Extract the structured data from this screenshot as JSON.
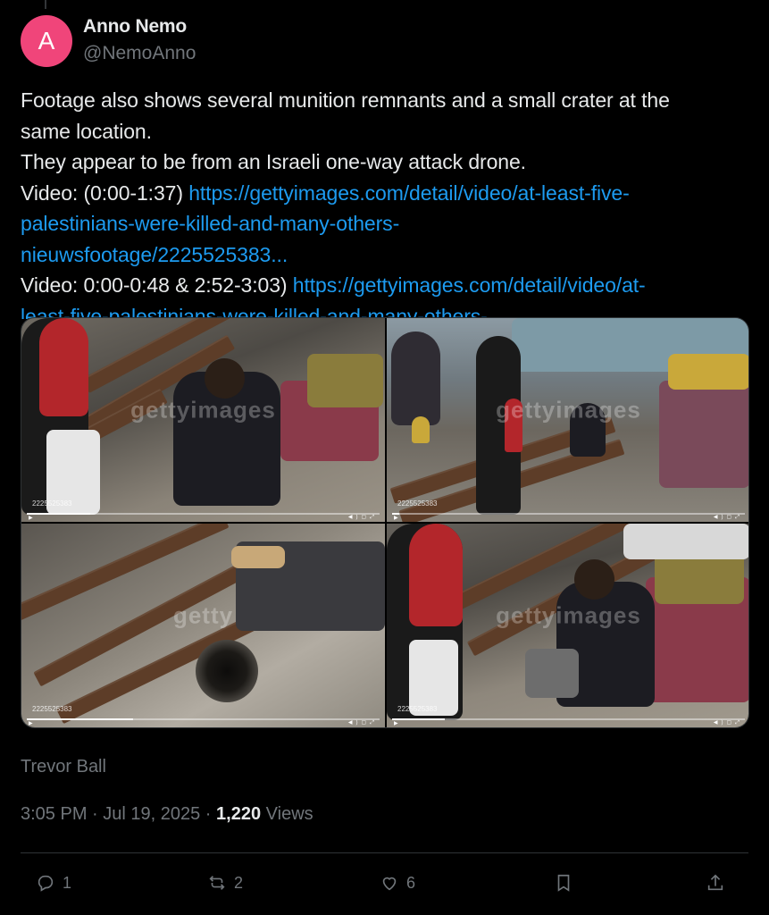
{
  "author": {
    "avatar_letter": "A",
    "avatar_color": "#f0457a",
    "name": "Anno Nemo",
    "handle": "@NemoAnno"
  },
  "tweet": {
    "line1": "Footage also shows several munition remnants and a small crater at the",
    "line2": "same location.",
    "line3": "They appear to be from an Israeli one-way attack drone.",
    "video1_label": "Video: (0:00-1:37) ",
    "video1_link_a": "https://gettyimages.com/detail/video/at-least-five-",
    "video1_link_b": "palestinians-were-killed-and-many-others-",
    "video1_link_c": "nieuwsfootage/2225525383...",
    "video2_label": "Video: 0:00-0:48 & 2:52-3:03) ",
    "video2_link_a": "https://gettyimages.com/detail/video/at-",
    "video2_link_b": "least-five-palestinians-were-killed-and-many-others-"
  },
  "media": {
    "frames": [
      {
        "watermark": "gettyimages",
        "video_id": "2225525383",
        "progress": 0.18
      },
      {
        "watermark": "gettyimages",
        "video_id": "2225525383",
        "progress": 0.02
      },
      {
        "watermark": "getty",
        "video_id": "2225525383",
        "progress": 0.3
      },
      {
        "watermark": "gettyimages",
        "video_id": "2225525383",
        "progress": 0.15
      }
    ]
  },
  "credit": "Trevor Ball",
  "meta": {
    "time": "3:05 PM",
    "separator": " · ",
    "date": "Jul 19, 2025",
    "separator2": " · ",
    "views_count": "1,220",
    "views_label": " Views"
  },
  "actions": {
    "replies": "1",
    "reposts": "2",
    "likes": "6"
  },
  "colors": {
    "background": "#000000",
    "text": "#e7e9ea",
    "muted": "#71767b",
    "link": "#1d9bf0"
  }
}
